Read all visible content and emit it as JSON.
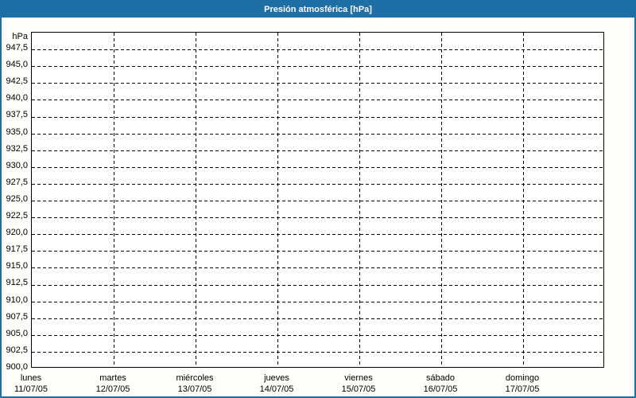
{
  "window": {
    "title": "Presión atmosférica [hPa]"
  },
  "colors": {
    "titlebar_bg": "#1d6fa5",
    "titlebar_text": "#ffffff",
    "window_border": "#1d6fa5",
    "page_bg": "#fdfdfa",
    "plot_bg": "#ffffff",
    "grid": "#000000",
    "text": "#000000"
  },
  "chart_data": {
    "type": "line",
    "title": "Presión atmosférica [hPa]",
    "xlabel": "",
    "ylabel": "hPa",
    "ylim": [
      900.0,
      950.0
    ],
    "ytick_step": 2.5,
    "ytick_labels": [
      "947,5",
      "945,0",
      "942,5",
      "940,0",
      "937,5",
      "935,0",
      "932,5",
      "930,0",
      "927,5",
      "925,0",
      "922,5",
      "920,0",
      "917,5",
      "915,0",
      "912,5",
      "910,0",
      "907,5",
      "905,0",
      "902,5",
      "900,0"
    ],
    "grid": true,
    "legend": false,
    "days": [
      {
        "name": "lunes",
        "date": "11/07/05"
      },
      {
        "name": "martes",
        "date": "12/07/05"
      },
      {
        "name": "miércoles",
        "date": "13/07/05"
      },
      {
        "name": "jueves",
        "date": "14/07/05"
      },
      {
        "name": "viernes",
        "date": "15/07/05"
      },
      {
        "name": "sábado",
        "date": "16/07/05"
      },
      {
        "name": "domingo",
        "date": "17/07/05"
      }
    ],
    "series": []
  }
}
